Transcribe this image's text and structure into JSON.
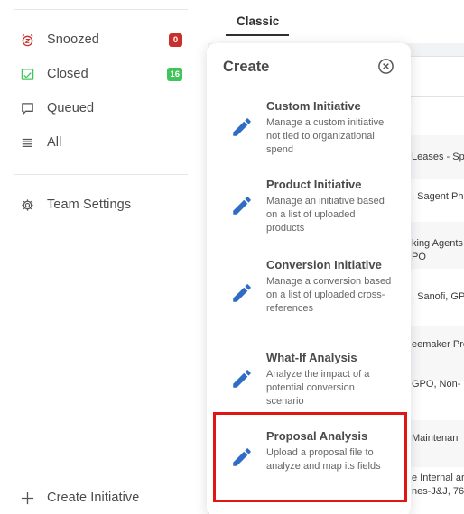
{
  "sidebar": {
    "items": [
      {
        "label": "Snoozed",
        "badge": "0",
        "badge_color": "#c9302c",
        "icon": "alarm-clock-icon"
      },
      {
        "label": "Closed",
        "badge": "16",
        "badge_color": "#3fc55a",
        "icon": "checklist-icon"
      },
      {
        "label": "Queued",
        "icon": "comment-box-icon"
      },
      {
        "label": "All",
        "icon": "list-icon"
      },
      {
        "label": "Team Settings",
        "icon": "gear-icon"
      }
    ],
    "create_initiative_label": "Create Initiative"
  },
  "main": {
    "tab_label": "Classic",
    "rows": [
      {
        "text": "Leases - Sp"
      },
      {
        "text": ", Sagent Ph"
      },
      {
        "text": "king Agents",
        "text2": "PO"
      },
      {
        "text": ", Sanofi, GP"
      },
      {
        "text": "eemaker Pro"
      },
      {
        "text": "GPO, Non-"
      },
      {
        "text": "Maintenan"
      },
      {
        "text": "e Internal ar",
        "text2": "nes-J&J, 76"
      }
    ]
  },
  "create_popover": {
    "title": "Create",
    "options": [
      {
        "title": "Custom Initiative",
        "description": "Manage a custom initiative not tied to organizational spend"
      },
      {
        "title": "Product Initiative",
        "description": "Manage an initiative based on a list of uploaded products"
      },
      {
        "title": "Conversion Initiative",
        "description": "Manage a conversion based on a list of uploaded cross-references"
      },
      {
        "title": "What-If Analysis",
        "description": "Analyze the impact of a potential conversion scenario"
      },
      {
        "title": "Proposal Analysis",
        "description": "Upload a proposal file to analyze and map its fields"
      }
    ],
    "highlighted_option": "Proposal Analysis",
    "highlight_color": "#e01515",
    "pencil_color": "#2f6cc6"
  }
}
